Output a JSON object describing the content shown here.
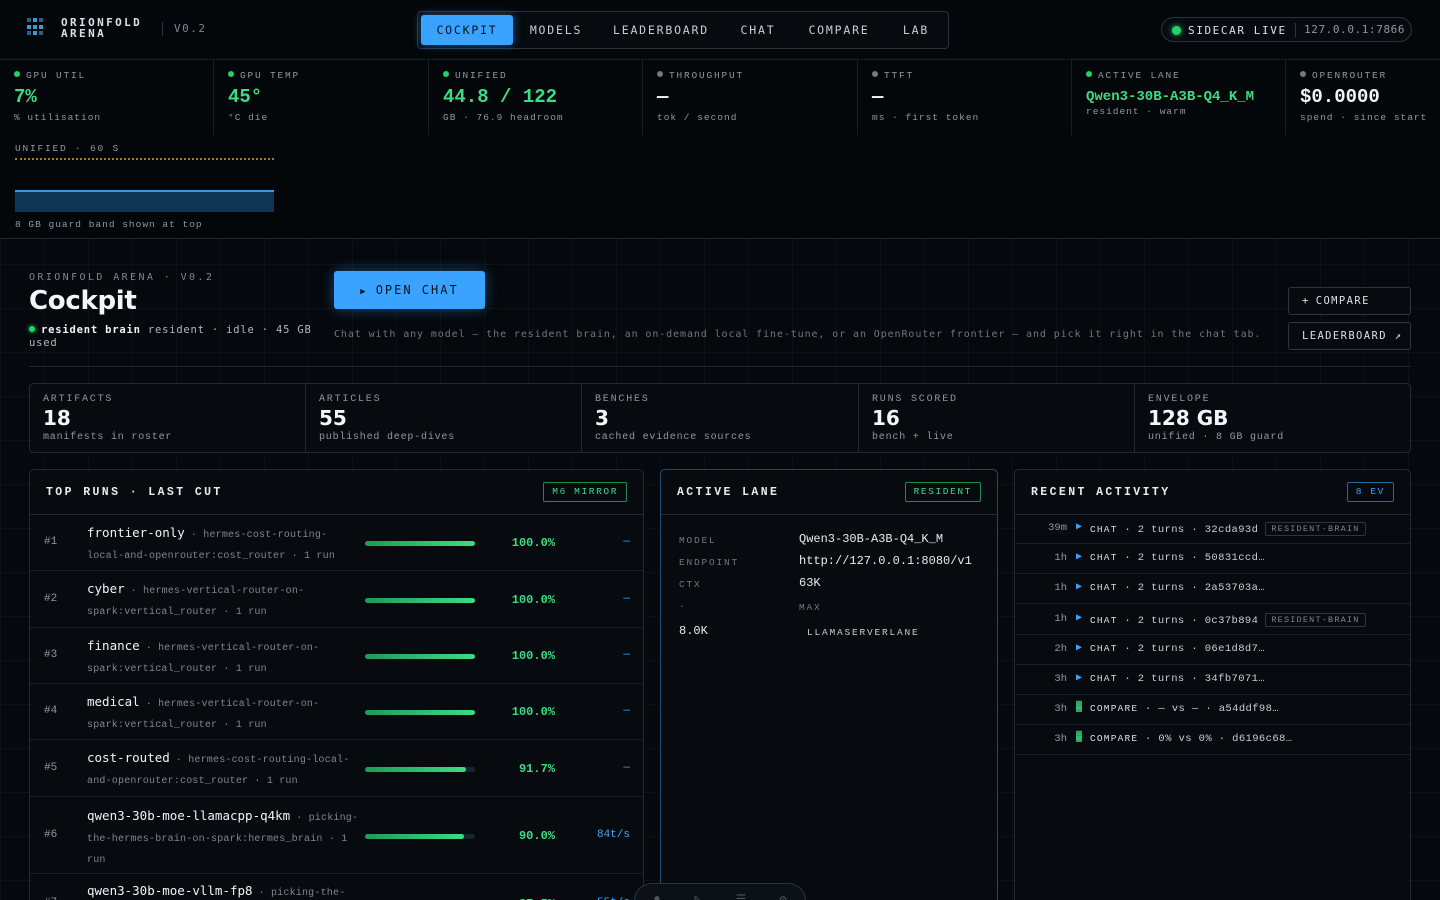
{
  "header": {
    "brand_line1": "ORIONFOLD",
    "brand_line2": "ARENA",
    "version": "V0.2",
    "nav": [
      "COCKPIT",
      "MODELS",
      "LEADERBOARD",
      "CHAT",
      "COMPARE",
      "LAB"
    ],
    "active_nav": "COCKPIT",
    "sidecar_label": "SIDECAR LIVE",
    "sidecar_addr": "127.0.0.1:7866"
  },
  "metrics": [
    {
      "label": "GPU UTIL",
      "value": "7%",
      "sub": "% utilisation",
      "status": "green"
    },
    {
      "label": "GPU TEMP",
      "value": "45°",
      "sub": "°C die",
      "status": "green"
    },
    {
      "label": "UNIFIED",
      "value": "44.8 / 122",
      "sub": "GB · 76.9 headroom",
      "status": "green"
    },
    {
      "label": "THROUGHPUT",
      "value": "—",
      "sub": "tok / second",
      "status": "idle"
    },
    {
      "label": "TTFT",
      "value": "—",
      "sub": "ms · first token",
      "status": "idle"
    },
    {
      "label": "ACTIVE LANE",
      "value": "Qwen3-30B-A3B-Q4_K_M",
      "sub": "resident · warm",
      "status": "green"
    },
    {
      "label": "OPENROUTER",
      "value": "$0.0000",
      "sub": "spend · since start",
      "status": "idle"
    }
  ],
  "unified_chart": {
    "title": "UNIFIED · 60 S",
    "caption": "8 GB guard band shown at top"
  },
  "hero": {
    "eyebrow": "ORIONFOLD ARENA · V0.2",
    "title": "Cockpit",
    "status_bold": "resident brain",
    "status_rest": "resident · idle · 45 GB used",
    "open_chat": "OPEN CHAT",
    "description": "Chat with any model — the resident brain, an on-demand local fine-tune, or an OpenRouter frontier — and pick it right in the chat tab.",
    "compare_btn": "COMPARE",
    "leaderboard_btn": "LEADERBOARD ↗"
  },
  "stats": [
    {
      "label": "ARTIFACTS",
      "value": "18",
      "sub": "manifests in roster"
    },
    {
      "label": "ARTICLES",
      "value": "55",
      "sub": "published deep-dives"
    },
    {
      "label": "BENCHES",
      "value": "3",
      "sub": "cached evidence sources"
    },
    {
      "label": "RUNS SCORED",
      "value": "16",
      "sub": "bench + live"
    },
    {
      "label": "ENVELOPE",
      "value": "128 GB",
      "sub": "unified · 8 GB guard"
    }
  ],
  "top_runs": {
    "title": "TOP RUNS · LAST CUT",
    "badge": "M6 MIRROR",
    "rows": [
      {
        "rank": "#1",
        "name": "frontier-only",
        "detail": "· hermes-cost-routing-local-and-openrouter:cost_router · 1 run",
        "score": 1.0,
        "pct": "100.0%",
        "tps": "—"
      },
      {
        "rank": "#2",
        "name": "cyber",
        "detail": "· hermes-vertical-router-on-spark:vertical_router · 1 run",
        "score": 1.0,
        "pct": "100.0%",
        "tps": "—"
      },
      {
        "rank": "#3",
        "name": "finance",
        "detail": "· hermes-vertical-router-on-spark:vertical_router · 1 run",
        "score": 1.0,
        "pct": "100.0%",
        "tps": "—"
      },
      {
        "rank": "#4",
        "name": "medical",
        "detail": "· hermes-vertical-router-on-spark:vertical_router · 1 run",
        "score": 1.0,
        "pct": "100.0%",
        "tps": "—"
      },
      {
        "rank": "#5",
        "name": "cost-routed",
        "detail": "· hermes-cost-routing-local-and-openrouter:cost_router · 1 run",
        "score": 0.917,
        "pct": "91.7%",
        "tps": "—"
      },
      {
        "rank": "#6",
        "name": "qwen3-30b-moe-llamacpp-q4km",
        "detail": "· picking-the-hermes-brain-on-spark:hermes_brain · 1 run",
        "score": 0.9,
        "pct": "90.0%",
        "tps": "84t/s"
      },
      {
        "rank": "#7",
        "name": "qwen3-30b-moe-vllm-fp8",
        "detail": "· picking-the-",
        "score": 0.875,
        "pct": "87.5%",
        "tps": "55t/s"
      }
    ]
  },
  "active_lane": {
    "title": "ACTIVE LANE",
    "badge": "RESIDENT",
    "model_label": "MODEL",
    "model": "Qwen3-30B-A3B-Q4_K_M",
    "endpoint_label": "ENDPOINT",
    "endpoint": "http://127.0.0.1:8080/v1",
    "ctx_label": "CTX",
    "ctx": "63K",
    "dot_label": "·",
    "max_label": "MAX",
    "max": "8.0K",
    "engine": "LLAMASERVERLANE"
  },
  "recent_activity": {
    "title": "RECENT ACTIVITY",
    "badge": "8 EV",
    "items": [
      {
        "time": "39m",
        "icon": "play-icon",
        "kind": "CHAT",
        "text": "· 2 turns · 32cda93d",
        "tag": "RESIDENT-BRAIN"
      },
      {
        "time": "1h",
        "icon": "play-icon",
        "kind": "CHAT",
        "text": "· 2 turns · 50831ccd…",
        "tag": ""
      },
      {
        "time": "1h",
        "icon": "play-icon",
        "kind": "CHAT",
        "text": "· 2 turns · 2a53703a…",
        "tag": ""
      },
      {
        "time": "1h",
        "icon": "play-icon",
        "kind": "CHAT",
        "text": "· 2 turns · 0c37b894",
        "tag": "RESIDENT-BRAIN"
      },
      {
        "time": "2h",
        "icon": "play-icon",
        "kind": "CHAT",
        "text": "· 2 turns · 06e1d8d7…",
        "tag": ""
      },
      {
        "time": "3h",
        "icon": "play-icon",
        "kind": "CHAT",
        "text": "· 2 turns · 34fb7071…",
        "tag": ""
      },
      {
        "time": "3h",
        "icon": "compare-icon",
        "kind": "COMPARE",
        "text": "· — vs — · a54ddf98…",
        "tag": ""
      },
      {
        "time": "3h",
        "icon": "compare-icon",
        "kind": "COMPARE",
        "text": "· 0% vs 0% · d6196c68…",
        "tag": ""
      }
    ]
  },
  "colors": {
    "accent": "#3aa3ff",
    "ok": "#3ddc84",
    "background": "#05080c"
  }
}
